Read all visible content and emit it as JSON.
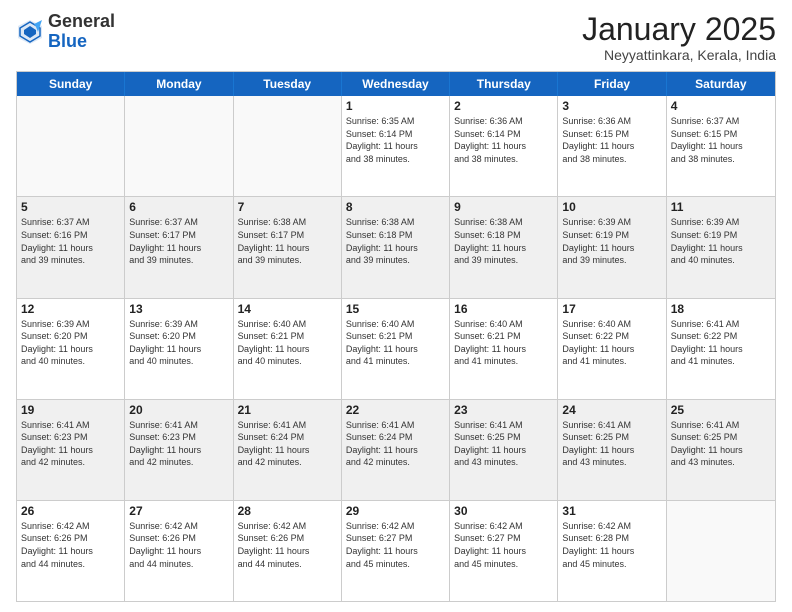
{
  "header": {
    "logo_general": "General",
    "logo_blue": "Blue",
    "month_title": "January 2025",
    "subtitle": "Neyyattinkara, Kerala, India"
  },
  "days_of_week": [
    "Sunday",
    "Monday",
    "Tuesday",
    "Wednesday",
    "Thursday",
    "Friday",
    "Saturday"
  ],
  "weeks": [
    [
      {
        "day": "",
        "info": ""
      },
      {
        "day": "",
        "info": ""
      },
      {
        "day": "",
        "info": ""
      },
      {
        "day": "1",
        "info": "Sunrise: 6:35 AM\nSunset: 6:14 PM\nDaylight: 11 hours\nand 38 minutes."
      },
      {
        "day": "2",
        "info": "Sunrise: 6:36 AM\nSunset: 6:14 PM\nDaylight: 11 hours\nand 38 minutes."
      },
      {
        "day": "3",
        "info": "Sunrise: 6:36 AM\nSunset: 6:15 PM\nDaylight: 11 hours\nand 38 minutes."
      },
      {
        "day": "4",
        "info": "Sunrise: 6:37 AM\nSunset: 6:15 PM\nDaylight: 11 hours\nand 38 minutes."
      }
    ],
    [
      {
        "day": "5",
        "info": "Sunrise: 6:37 AM\nSunset: 6:16 PM\nDaylight: 11 hours\nand 39 minutes."
      },
      {
        "day": "6",
        "info": "Sunrise: 6:37 AM\nSunset: 6:17 PM\nDaylight: 11 hours\nand 39 minutes."
      },
      {
        "day": "7",
        "info": "Sunrise: 6:38 AM\nSunset: 6:17 PM\nDaylight: 11 hours\nand 39 minutes."
      },
      {
        "day": "8",
        "info": "Sunrise: 6:38 AM\nSunset: 6:18 PM\nDaylight: 11 hours\nand 39 minutes."
      },
      {
        "day": "9",
        "info": "Sunrise: 6:38 AM\nSunset: 6:18 PM\nDaylight: 11 hours\nand 39 minutes."
      },
      {
        "day": "10",
        "info": "Sunrise: 6:39 AM\nSunset: 6:19 PM\nDaylight: 11 hours\nand 39 minutes."
      },
      {
        "day": "11",
        "info": "Sunrise: 6:39 AM\nSunset: 6:19 PM\nDaylight: 11 hours\nand 40 minutes."
      }
    ],
    [
      {
        "day": "12",
        "info": "Sunrise: 6:39 AM\nSunset: 6:20 PM\nDaylight: 11 hours\nand 40 minutes."
      },
      {
        "day": "13",
        "info": "Sunrise: 6:39 AM\nSunset: 6:20 PM\nDaylight: 11 hours\nand 40 minutes."
      },
      {
        "day": "14",
        "info": "Sunrise: 6:40 AM\nSunset: 6:21 PM\nDaylight: 11 hours\nand 40 minutes."
      },
      {
        "day": "15",
        "info": "Sunrise: 6:40 AM\nSunset: 6:21 PM\nDaylight: 11 hours\nand 41 minutes."
      },
      {
        "day": "16",
        "info": "Sunrise: 6:40 AM\nSunset: 6:21 PM\nDaylight: 11 hours\nand 41 minutes."
      },
      {
        "day": "17",
        "info": "Sunrise: 6:40 AM\nSunset: 6:22 PM\nDaylight: 11 hours\nand 41 minutes."
      },
      {
        "day": "18",
        "info": "Sunrise: 6:41 AM\nSunset: 6:22 PM\nDaylight: 11 hours\nand 41 minutes."
      }
    ],
    [
      {
        "day": "19",
        "info": "Sunrise: 6:41 AM\nSunset: 6:23 PM\nDaylight: 11 hours\nand 42 minutes."
      },
      {
        "day": "20",
        "info": "Sunrise: 6:41 AM\nSunset: 6:23 PM\nDaylight: 11 hours\nand 42 minutes."
      },
      {
        "day": "21",
        "info": "Sunrise: 6:41 AM\nSunset: 6:24 PM\nDaylight: 11 hours\nand 42 minutes."
      },
      {
        "day": "22",
        "info": "Sunrise: 6:41 AM\nSunset: 6:24 PM\nDaylight: 11 hours\nand 42 minutes."
      },
      {
        "day": "23",
        "info": "Sunrise: 6:41 AM\nSunset: 6:25 PM\nDaylight: 11 hours\nand 43 minutes."
      },
      {
        "day": "24",
        "info": "Sunrise: 6:41 AM\nSunset: 6:25 PM\nDaylight: 11 hours\nand 43 minutes."
      },
      {
        "day": "25",
        "info": "Sunrise: 6:41 AM\nSunset: 6:25 PM\nDaylight: 11 hours\nand 43 minutes."
      }
    ],
    [
      {
        "day": "26",
        "info": "Sunrise: 6:42 AM\nSunset: 6:26 PM\nDaylight: 11 hours\nand 44 minutes."
      },
      {
        "day": "27",
        "info": "Sunrise: 6:42 AM\nSunset: 6:26 PM\nDaylight: 11 hours\nand 44 minutes."
      },
      {
        "day": "28",
        "info": "Sunrise: 6:42 AM\nSunset: 6:26 PM\nDaylight: 11 hours\nand 44 minutes."
      },
      {
        "day": "29",
        "info": "Sunrise: 6:42 AM\nSunset: 6:27 PM\nDaylight: 11 hours\nand 45 minutes."
      },
      {
        "day": "30",
        "info": "Sunrise: 6:42 AM\nSunset: 6:27 PM\nDaylight: 11 hours\nand 45 minutes."
      },
      {
        "day": "31",
        "info": "Sunrise: 6:42 AM\nSunset: 6:28 PM\nDaylight: 11 hours\nand 45 minutes."
      },
      {
        "day": "",
        "info": ""
      }
    ]
  ]
}
